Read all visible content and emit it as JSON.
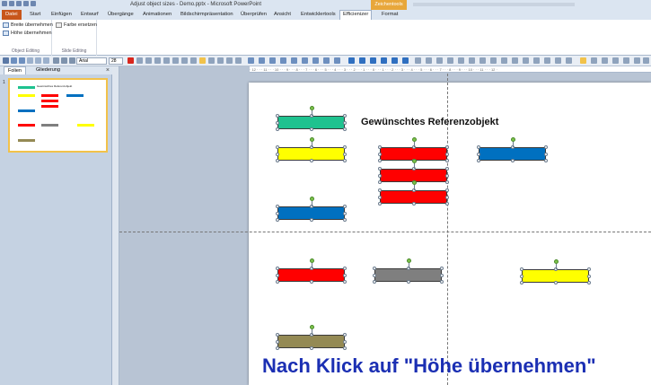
{
  "window": {
    "title": "Adjust object sizes - Demo.pptx - Microsoft PowerPoint",
    "context_tab": "Zeichentools"
  },
  "ribbon_tabs": [
    "Datei",
    "Start",
    "Einfügen",
    "Entwurf",
    "Übergänge",
    "Animationen",
    "Bildschirmpräsentation",
    "Überprüfen",
    "Ansicht",
    "Entwicklertools",
    "Efficienizer",
    "Format"
  ],
  "active_tab": "Efficienizer",
  "ribbon": {
    "object_editing": {
      "label": "Object Editing",
      "width_button": "Breite übernehmen",
      "height_button": "Höhe übernehmen"
    },
    "slide_editing": {
      "label": "Slide Editing",
      "color_button": "Farbe ersetzen"
    }
  },
  "toolbar": {
    "font_name": "Arial",
    "font_size": "28"
  },
  "slide_panel": {
    "tab_slides": "Folien",
    "tab_outline": "Gliederung",
    "close": "×",
    "slide_number": "1",
    "thumb_title": "Gewünschtes Referenzobjekt"
  },
  "ruler_text": "· 12 · · · 11 · · · 10 · · · 9 · · · 8 · · · 7 · · · 6 · · · 5 · · · 4 · · · 3 · · · 2 · · · 1 · · · 0 · · · 1 · · · 2 · · · 3 · · · 4 · · · 5 · · · 6 · · · 7 · · · 8 · · · 9 · · · 10 · · · 11 · · · 12 ·",
  "slide": {
    "reference_label": "Gewünschtes Referenzobjekt",
    "caption": "Nach Klick auf \"Höhe übernehmen\""
  },
  "colors": {
    "teal": "#1fc28f",
    "yellow": "#ffff00",
    "red": "#ff0000",
    "blue": "#0070c0",
    "gray": "#7f7f7f",
    "olive": "#948a54",
    "caption_blue": "#1b2fb3"
  }
}
